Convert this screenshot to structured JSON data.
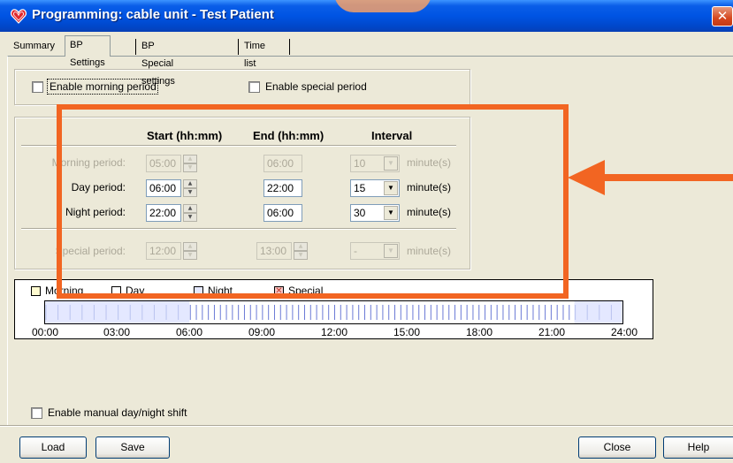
{
  "window": {
    "title": "Programming: cable unit - Test Patient",
    "close_glyph": "✕"
  },
  "tabs": [
    {
      "label": "Summary"
    },
    {
      "label": "BP Settings"
    },
    {
      "label": "BP Special settings"
    },
    {
      "label": "Time list"
    }
  ],
  "options": {
    "enable_morning": "Enable morning period",
    "enable_special": "Enable special period"
  },
  "schedule": {
    "headers": {
      "start": "Start (hh:mm)",
      "end": "End (hh:mm)",
      "interval": "Interval"
    },
    "rows": [
      {
        "label": "Morning period:",
        "start": "05:00",
        "end": "06:00",
        "interval": "10",
        "unit": "minute(s)"
      },
      {
        "label": "Day period:",
        "start": "06:00",
        "end": "22:00",
        "interval": "15",
        "unit": "minute(s)"
      },
      {
        "label": "Night period:",
        "start": "22:00",
        "end": "06:00",
        "interval": "30",
        "unit": "minute(s)"
      }
    ],
    "special": {
      "label": "Special period:",
      "start": "12:00",
      "end": "13:00",
      "interval": "-",
      "unit": "minute(s)"
    }
  },
  "legend": {
    "morning": "Morning",
    "day": "Day",
    "night": "Night",
    "special": "Special"
  },
  "timeline": {
    "labels": [
      "00:00",
      "03:00",
      "06:00",
      "09:00",
      "12:00",
      "15:00",
      "18:00",
      "21:00",
      "24:00"
    ],
    "day_start_hour": 6,
    "day_end_hour": 22,
    "colors": {
      "night": "#e4e8ff",
      "day_ticks": "#6b7ad6",
      "night_ticks": "#b9c3ef"
    }
  },
  "manual_shift": {
    "label": "Enable manual day/night shift"
  },
  "buttons": {
    "load": "Load",
    "save": "Save",
    "close": "Close",
    "help": "Help"
  },
  "annotation": {
    "color": "#f26522"
  }
}
